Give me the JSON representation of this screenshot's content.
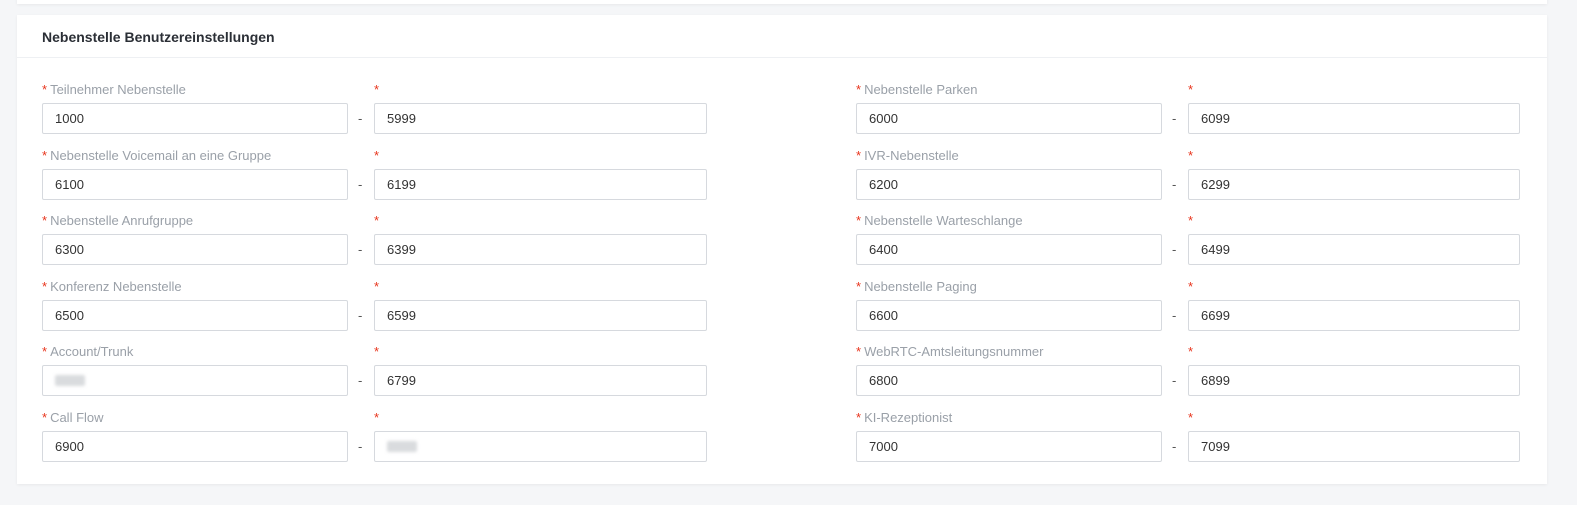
{
  "section": {
    "title": "Nebenstelle Benutzereinstellungen"
  },
  "required_marker": "*",
  "range_separator": "-",
  "left_column": [
    {
      "label": "Teilnehmer Nebenstelle",
      "start": "1000",
      "end": "5999",
      "start_redacted": false,
      "end_redacted": false
    },
    {
      "label": "Nebenstelle Voicemail an eine Gruppe",
      "start": "6100",
      "end": "6199",
      "start_redacted": false,
      "end_redacted": false
    },
    {
      "label": "Nebenstelle Anrufgruppe",
      "start": "6300",
      "end": "6399",
      "start_redacted": false,
      "end_redacted": false
    },
    {
      "label": "Konferenz Nebenstelle",
      "start": "6500",
      "end": "6599",
      "start_redacted": false,
      "end_redacted": false
    },
    {
      "label": "Account/Trunk",
      "start": "",
      "end": "6799",
      "start_redacted": true,
      "end_redacted": false
    },
    {
      "label": "Call Flow",
      "start": "6900",
      "end": "",
      "start_redacted": false,
      "end_redacted": true
    }
  ],
  "right_column": [
    {
      "label": "Nebenstelle Parken",
      "start": "6000",
      "end": "6099",
      "start_redacted": false,
      "end_redacted": false
    },
    {
      "label": "IVR-Nebenstelle",
      "start": "6200",
      "end": "6299",
      "start_redacted": false,
      "end_redacted": false
    },
    {
      "label": "Nebenstelle Warteschlange",
      "start": "6400",
      "end": "6499",
      "start_redacted": false,
      "end_redacted": false
    },
    {
      "label": "Nebenstelle Paging",
      "start": "6600",
      "end": "6699",
      "start_redacted": false,
      "end_redacted": false
    },
    {
      "label": "WebRTC-Amtsleitungsnummer",
      "start": "6800",
      "end": "6899",
      "start_redacted": false,
      "end_redacted": false
    },
    {
      "label": "KI-Rezeptionist",
      "start": "7000",
      "end": "7099",
      "start_redacted": false,
      "end_redacted": false
    }
  ]
}
